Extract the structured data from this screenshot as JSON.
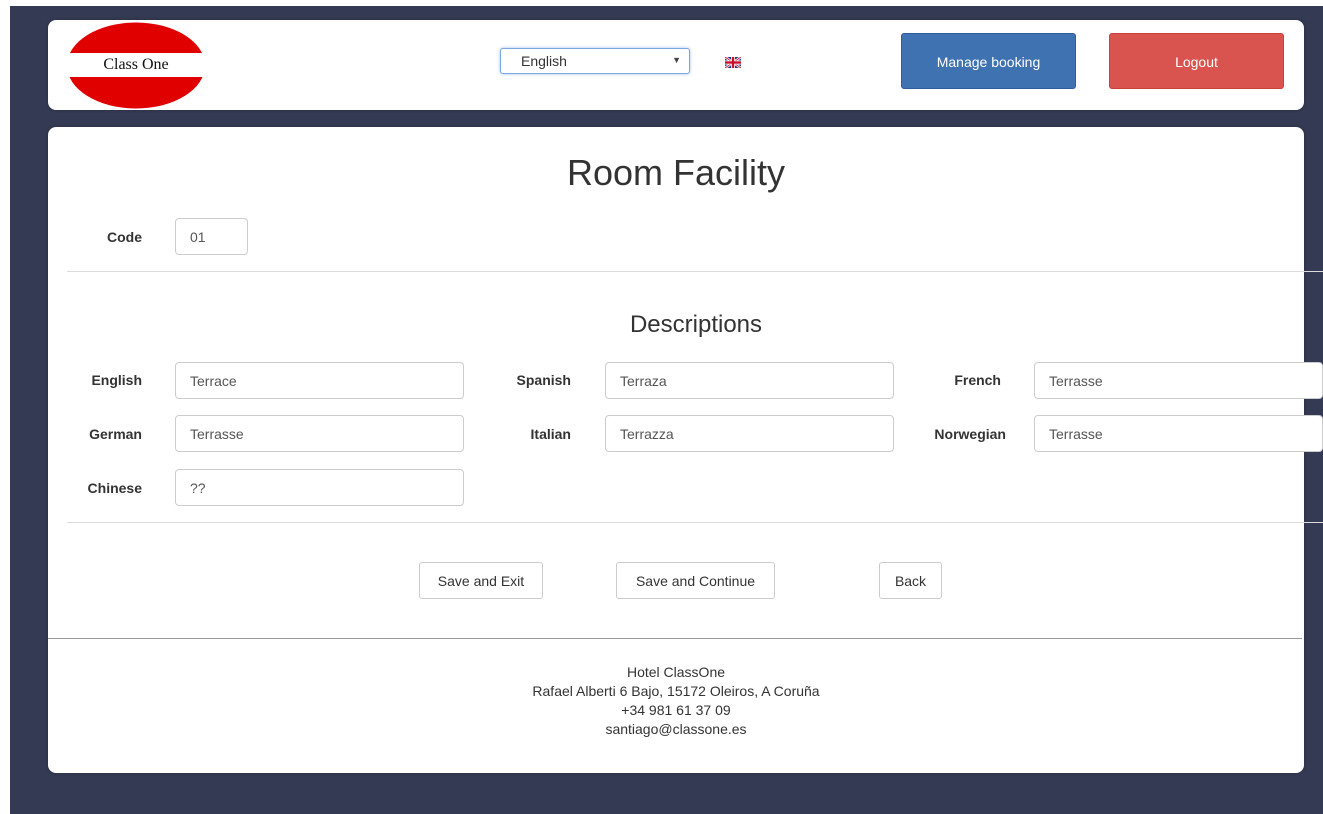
{
  "header": {
    "logo_text": "Class One",
    "language_select": {
      "selected": "English"
    },
    "manage_booking_label": "Manage booking",
    "logout_label": "Logout"
  },
  "page": {
    "title": "Room Facility",
    "code_label": "Code",
    "code_value": "01",
    "descriptions_title": "Descriptions"
  },
  "descriptions": [
    {
      "label": "English",
      "value": "Terrace"
    },
    {
      "label": "Spanish",
      "value": "Terraza"
    },
    {
      "label": "French",
      "value": "Terrasse"
    },
    {
      "label": "German",
      "value": "Terrasse"
    },
    {
      "label": "Italian",
      "value": "Terrazza"
    },
    {
      "label": "Norwegian",
      "value": "Terrasse"
    },
    {
      "label": "Chinese",
      "value": "??"
    }
  ],
  "actions": {
    "save_exit": "Save and Exit",
    "save_continue": "Save and Continue",
    "back": "Back"
  },
  "footer": {
    "name": "Hotel ClassOne",
    "address": "Rafael Alberti 6 Bajo, 15172 Oleiros, A Coruña",
    "phone": "+34 981 61 37 09",
    "email": "santiago@classone.es"
  },
  "colors": {
    "background": "#343a53",
    "manage_button": "#3f72b1",
    "logout_button": "#d9534f",
    "logo_red": "#e00000"
  }
}
